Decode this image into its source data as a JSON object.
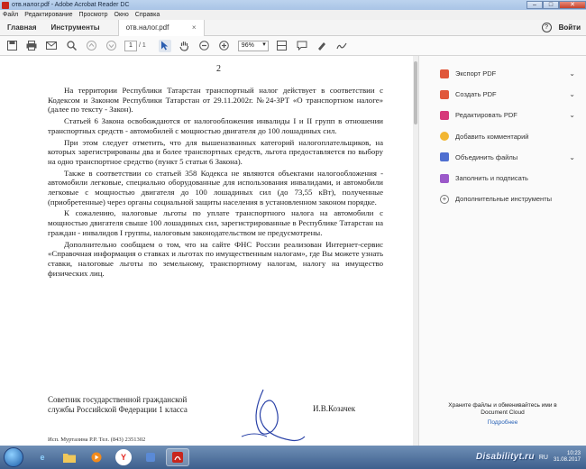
{
  "window": {
    "title": "отв.налог.pdf - Adobe Acrobat Reader DC",
    "btn_min": "–",
    "btn_max": "□",
    "btn_close": "✕"
  },
  "menu": [
    "Файл",
    "Редактирование",
    "Просмотр",
    "Окно",
    "Справка"
  ],
  "tabs": {
    "home": "Главная",
    "tools": "Инструменты",
    "file": "отв.налог.pdf",
    "file_close": "×",
    "help": "?",
    "signin": "Войти"
  },
  "toolbar": {
    "page_current": "1",
    "page_count": "/ 1",
    "zoom": "96%"
  },
  "document": {
    "page_number": "2",
    "paragraphs": [
      "На территории Республики  Татарстан транспортный налог действует в соответствии с Кодексом и Законом Республики Татарстан от 29.11.2002г. №24-ЗРТ «О транспортном налоге» (далее по тексту - Закон).",
      "Статьей 6 Закона освобождаются от налогообложения инвалиды I и II групп в отношении транспортных средств - автомобилей с мощностью двигателя до 100 лошадиных сил.",
      "При этом следует отметить, что для вышеназванных категорий налогоплательщиков, на которых зарегистрированы два и более транспортных средств, льгота предоставляется по выбору на одно транспортное средство (пункт 5 статьи 6 Закона).",
      "Также в соответствии со статьей 358 Кодекса не являются объектами налогообложения - автомобили легковые, специально оборудованные для использования инвалидами, и автомобили легковые с мощностью двигателя до 100 лошадиных сил (до 73,55 кВт), полученные (приобретенные) через органы социальной защиты населения в установленном законом порядке.",
      "К сожалению, налоговые льготы по уплате транспортного налога на автомобили с мощностью двигателя свыше 100 лошадиных сил, зарегистрированные в Республике Татарстан на граждан - инвалидов I группы, налоговым законодательством не предусмотрены.",
      "Дополнительно сообщаем о том, что на сайте ФНС России реализован Интернет-сервис «Справочная информация о ставках и льготах по имущественным налогам», где Вы можете узнать ставки, налоговые льготы по земельному, транспортному налогам, налогу на имущество физических лиц."
    ],
    "signer_title_line1": "Советник государственной гражданской",
    "signer_title_line2": "службы Российской Федерации 1 класса",
    "signer_name": "И.В.Козачек",
    "footer": "Исп. Муртазина Р.Р. Тел. (843) 2351302"
  },
  "right_panel": {
    "items": [
      {
        "label": "Экспорт PDF",
        "color": "#e0573a",
        "chevron": true
      },
      {
        "label": "Создать PDF",
        "color": "#e0573a",
        "chevron": true
      },
      {
        "label": "Редактировать PDF",
        "color": "#d6397a",
        "chevron": true
      },
      {
        "label": "Добавить комментарий",
        "color": "#f2b632",
        "chevron": false
      },
      {
        "label": "Объединить файлы",
        "color": "#4f6fd0",
        "chevron": true
      },
      {
        "label": "Заполнить и подписать",
        "color": "#9b59c9",
        "chevron": false
      },
      {
        "label": "Дополнительные инструменты",
        "color": "#777777",
        "chevron": false
      }
    ],
    "cloud_text_1": "Храните файлы и обменивайтесь ими в",
    "cloud_text_2": "Document Cloud",
    "cloud_more": "Подробнее"
  },
  "taskbar": {
    "lang": "RU",
    "time": "10:23",
    "date": "31.08.2017"
  },
  "watermark": "Disabilityt.ru"
}
